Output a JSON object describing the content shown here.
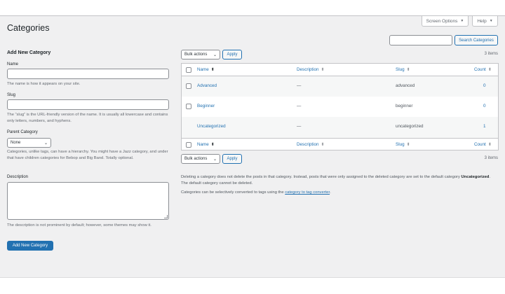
{
  "header": {
    "screen_options_label": "Screen Options",
    "help_label": "Help",
    "caret": "▼"
  },
  "page": {
    "title": "Categories"
  },
  "search": {
    "button_label": "Search Categories",
    "value": ""
  },
  "form": {
    "title": "Add New Category",
    "name_label": "Name",
    "name_help": "The name is how it appears on your site.",
    "slug_label": "Slug",
    "slug_help": "The “slug” is the URL-friendly version of the name. It is usually all lowercase and contains only letters, numbers, and hyphens.",
    "parent_label": "Parent Category",
    "parent_value": "None",
    "parent_help": "Categories, unlike tags, can have a hierarchy. You might have a Jazz category, and under that have children categories for Bebop and Big Band. Totally optional.",
    "description_label": "Description",
    "description_help": "The description is not prominent by default; however, some themes may show it.",
    "submit_label": "Add New Category"
  },
  "bulk": {
    "top_value": "Bulk actions",
    "bottom_value": "Bulk actions",
    "apply_label": "Apply"
  },
  "table": {
    "items_count": "3 items",
    "columns": {
      "name": "Name",
      "description": "Description",
      "slug": "Slug",
      "count": "Count"
    },
    "sort_name": "⬍",
    "sort_other": "⬍",
    "rows": [
      {
        "name": "Advanced",
        "description": "—",
        "slug": "advanced",
        "count": "0"
      },
      {
        "name": "Beginner",
        "description": "—",
        "slug": "beginner",
        "count": "0"
      },
      {
        "name": "Uncategorized",
        "description": "—",
        "slug": "uncategorized",
        "count": "1"
      }
    ]
  },
  "notes": {
    "delete_pre": "Deleting a category does not delete the posts in that category. Instead, posts that were only assigned to the deleted category are set to the default category",
    "delete_bold": "Uncategorized",
    "delete_post": ". The default category cannot be deleted.",
    "convert_pre": "Categories can be selectively converted to tags using the",
    "convert_link": "category to tag converter",
    "convert_post": "."
  },
  "colors": {
    "accent": "#2271b1",
    "background": "#f0f0f1"
  }
}
